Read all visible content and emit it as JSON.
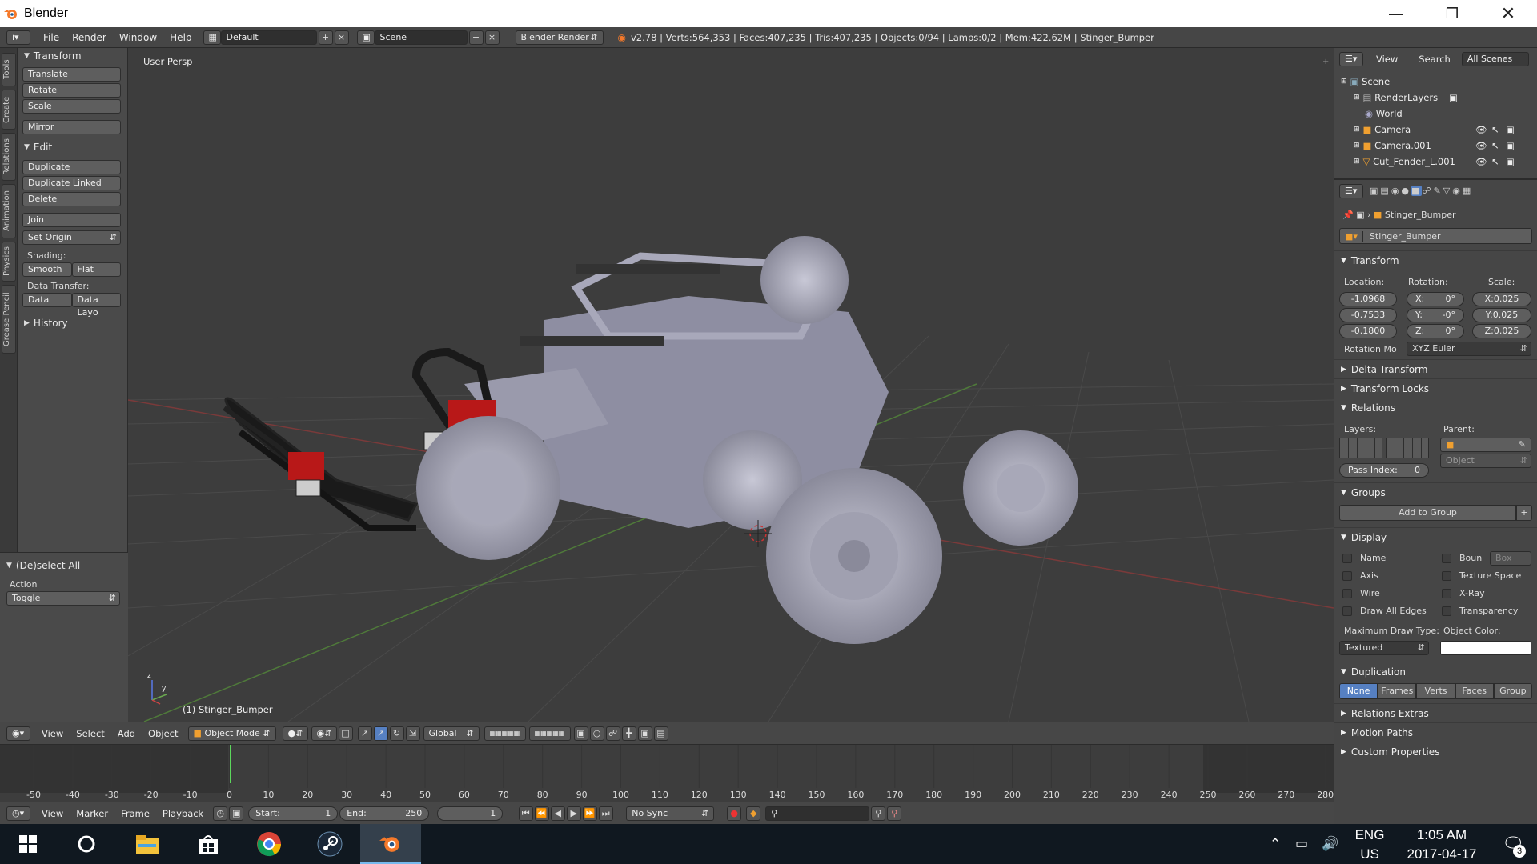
{
  "window": {
    "title": "Blender",
    "minimize_icon": "minimize-icon",
    "maximize_icon": "restore-icon",
    "close_icon": "close-icon"
  },
  "info_header": {
    "menus": [
      "File",
      "Render",
      "Window",
      "Help"
    ],
    "screen_layout": "Default",
    "scene": "Scene",
    "render_engine": "Blender Render",
    "stats": "v2.78 | Verts:564,353 | Faces:407,235 | Tris:407,235 | Objects:0/94 | Lamps:0/2 | Mem:422.62M | Stinger_Bumper"
  },
  "tool_tabs": [
    "Tools",
    "Create",
    "Relations",
    "Animation",
    "Physics",
    "Grease Pencil"
  ],
  "toolshelf": {
    "transform_title": "Transform",
    "transform_buttons": [
      "Translate",
      "Rotate",
      "Scale"
    ],
    "mirror": "Mirror",
    "edit_title": "Edit",
    "edit_buttons": [
      "Duplicate",
      "Duplicate Linked",
      "Delete"
    ],
    "join": "Join",
    "set_origin": "Set Origin",
    "shading_label": "Shading:",
    "smooth": "Smooth",
    "flat": "Flat",
    "data_transfer_label": "Data Transfer:",
    "data": "Data",
    "data_layo": "Data Layo",
    "history_title": "History"
  },
  "last_operator": {
    "title": "(De)select All",
    "action_label": "Action",
    "action_value": "Toggle"
  },
  "viewport": {
    "view_name": "User Persp",
    "active_object": "(1) Stinger_Bumper",
    "axis_z": "z",
    "axis_y": "y"
  },
  "view3d_header": {
    "menus": [
      "View",
      "Select",
      "Add",
      "Object"
    ],
    "mode": "Object Mode",
    "orientation": "Global"
  },
  "timeline": {
    "ticks": [
      "-50",
      "-40",
      "-30",
      "-20",
      "-10",
      "0",
      "10",
      "20",
      "30",
      "40",
      "50",
      "60",
      "70",
      "80",
      "90",
      "100",
      "110",
      "120",
      "130",
      "140",
      "150",
      "160",
      "170",
      "180",
      "190",
      "200",
      "210",
      "220",
      "230",
      "240",
      "250",
      "260",
      "270",
      "280"
    ],
    "current_frame_marker": 0
  },
  "timeline_header": {
    "menus": [
      "View",
      "Marker",
      "Frame",
      "Playback"
    ],
    "start_label": "Start:",
    "start_value": "1",
    "end_label": "End:",
    "end_value": "250",
    "current_frame": "1",
    "sync": "No Sync"
  },
  "outliner": {
    "menus": [
      "View",
      "Search"
    ],
    "filter": "All Scenes",
    "rows": [
      {
        "name": "Scene",
        "icon": "scene-icon"
      },
      {
        "name": "RenderLayers",
        "icon": "renderlayers-icon"
      },
      {
        "name": "World",
        "icon": "world-icon"
      },
      {
        "name": "Camera",
        "icon": "camera-icon"
      },
      {
        "name": "Camera.001",
        "icon": "camera-icon"
      },
      {
        "name": "Cut_Fender_L.001",
        "icon": "mesh-icon"
      }
    ]
  },
  "properties": {
    "breadcrumb": "Stinger_Bumper",
    "object_name": "Stinger_Bumper",
    "transform": {
      "title": "Transform",
      "location_label": "Location:",
      "rotation_label": "Rotation:",
      "scale_label": "Scale:",
      "location": [
        "-1.0968",
        "-0.7533",
        "-0.1800"
      ],
      "rotation": [
        {
          "axis": "X:",
          "value": "0°"
        },
        {
          "axis": "Y:",
          "value": "-0°"
        },
        {
          "axis": "Z:",
          "value": "0°"
        }
      ],
      "scale": [
        "X:0.025",
        "Y:0.025",
        "Z:0.025"
      ],
      "rotation_mode_label": "Rotation Mo",
      "rotation_mode": "XYZ Euler"
    },
    "delta_transform": "Delta Transform",
    "transform_locks": "Transform Locks",
    "relations": {
      "title": "Relations",
      "layers_label": "Layers:",
      "parent_label": "Parent:",
      "parent_type": "Object",
      "pass_index_label": "Pass Index:",
      "pass_index": "0"
    },
    "groups": {
      "title": "Groups",
      "add": "Add to Group"
    },
    "display": {
      "title": "Display",
      "left": [
        "Name",
        "Axis",
        "Wire",
        "Draw All Edges"
      ],
      "right": [
        "Boun",
        "Texture Space",
        "X-Ray",
        "Transparency"
      ],
      "bounds_type": "Box",
      "max_draw_label": "Maximum Draw Type:",
      "max_draw": "Textured",
      "object_color_label": "Object Color:"
    },
    "duplication": {
      "title": "Duplication",
      "options": [
        "None",
        "Frames",
        "Verts",
        "Faces",
        "Group"
      ],
      "active": "None"
    },
    "relations_extras": "Relations Extras",
    "motion_paths": "Motion Paths",
    "custom_properties": "Custom Properties"
  },
  "taskbar": {
    "apps": [
      "windows-start-icon",
      "cortana-icon",
      "file-explorer-icon",
      "store-icon",
      "chrome-icon",
      "steam-icon",
      "blender-icon"
    ],
    "lang1": "ENG",
    "lang2": "US",
    "time": "1:05 AM",
    "date": "2017-04-17",
    "notifications": "3"
  },
  "colors": {
    "accent": "#5680c2",
    "bg_dark": "#3d3d3d",
    "panel": "#4a4a4a",
    "taskbar": "#101820"
  }
}
